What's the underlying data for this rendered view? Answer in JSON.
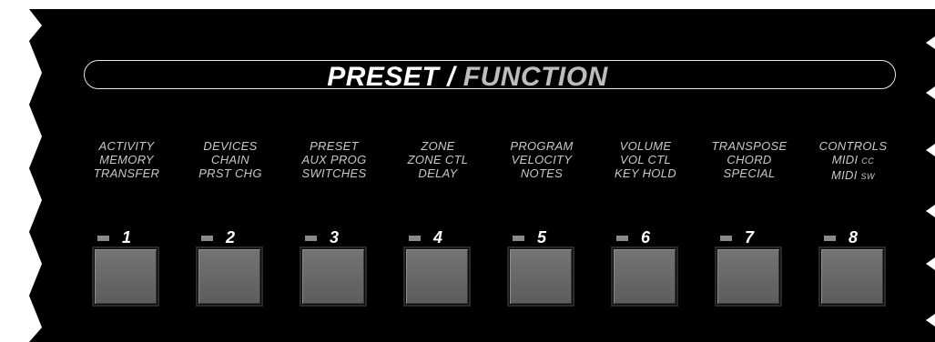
{
  "panel": {
    "title_preset": "PRESET",
    "title_slash": " / ",
    "title_function": "FUNCTION"
  },
  "buttons": [
    {
      "number": "1",
      "lines": [
        [
          "ACTIVITY",
          ""
        ],
        [
          "MEMORY",
          ""
        ],
        [
          "TRANSFER",
          ""
        ]
      ]
    },
    {
      "number": "2",
      "lines": [
        [
          "DEVICES",
          ""
        ],
        [
          "CHAIN",
          ""
        ],
        [
          "PRST CHG",
          ""
        ]
      ]
    },
    {
      "number": "3",
      "lines": [
        [
          "PRESET",
          ""
        ],
        [
          "AUX PROG",
          ""
        ],
        [
          "SWITCHES",
          ""
        ]
      ]
    },
    {
      "number": "4",
      "lines": [
        [
          "ZONE",
          ""
        ],
        [
          "ZONE CTL",
          ""
        ],
        [
          "DELAY",
          ""
        ]
      ]
    },
    {
      "number": "5",
      "lines": [
        [
          "PROGRAM",
          ""
        ],
        [
          "VELOCITY",
          ""
        ],
        [
          "NOTES",
          ""
        ]
      ]
    },
    {
      "number": "6",
      "lines": [
        [
          "VOLUME",
          ""
        ],
        [
          "VOL CTL",
          ""
        ],
        [
          "KEY HOLD",
          ""
        ]
      ]
    },
    {
      "number": "7",
      "lines": [
        [
          "TRANSPOSE",
          ""
        ],
        [
          "CHORD",
          ""
        ],
        [
          "SPECIAL",
          ""
        ]
      ]
    },
    {
      "number": "8",
      "lines": [
        [
          "CONTROLS",
          ""
        ],
        [
          "MIDI ",
          "CC"
        ],
        [
          "MIDI ",
          "SW"
        ]
      ]
    }
  ],
  "colors": {
    "panel_bg": "#000000",
    "label_text": "#c8c8c8",
    "button_face": "#6a6a6a",
    "led_off": "#8a8a8a"
  }
}
